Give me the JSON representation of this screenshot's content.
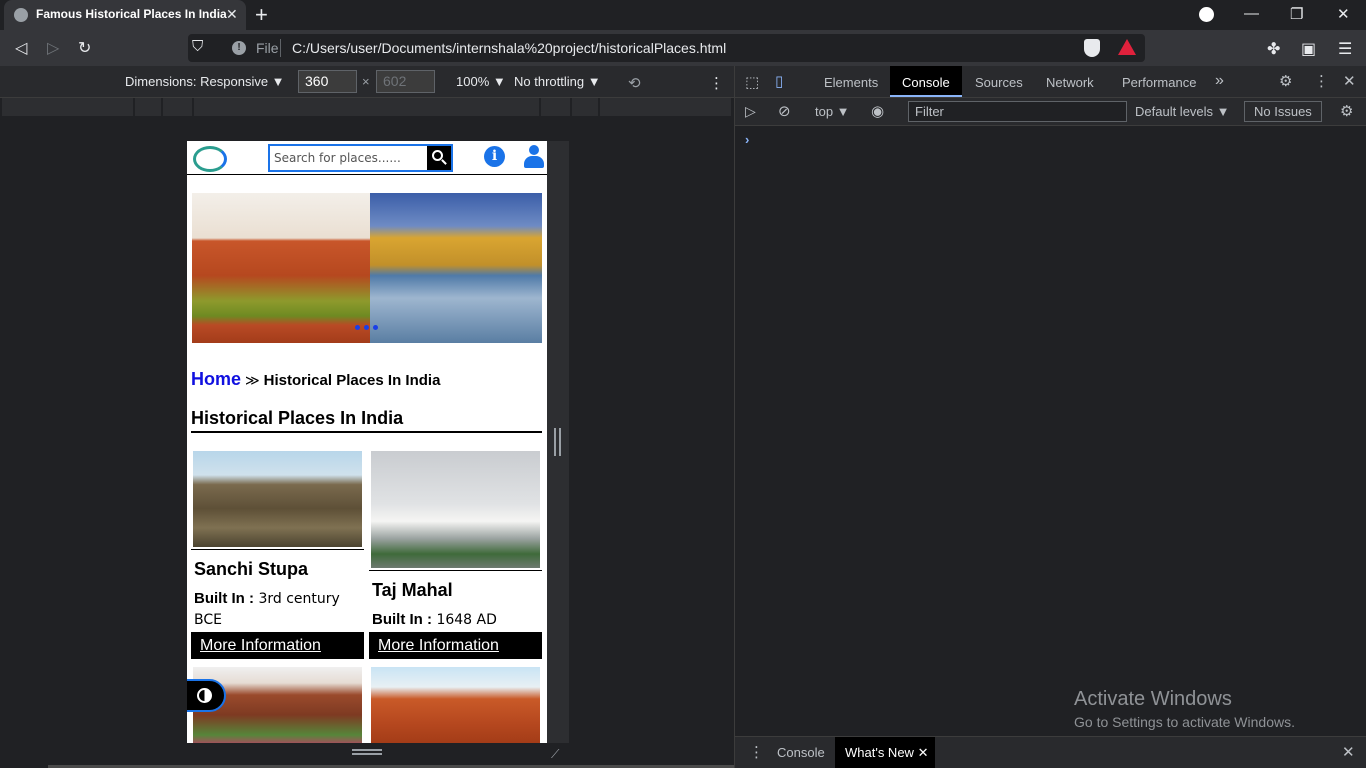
{
  "browser": {
    "tab_title": "Famous Historical Places In India",
    "tab_close": "✕",
    "new_tab": "+",
    "url_scheme": "File",
    "url": "C:/Users/user/Documents/internshala%20project/historicalPlaces.html"
  },
  "device_toolbar": {
    "dimensions_label": "Dimensions: Responsive ▼",
    "width": "360",
    "times": "×",
    "height": "602",
    "zoom": "100% ▼",
    "throttling": "No throttling ▼"
  },
  "site": {
    "search_placeholder": "Search for places......",
    "breadcrumb": {
      "home": "Home",
      "separator": "≫",
      "current": "Historical Places In India"
    },
    "heading": "Historical Places In India",
    "cards": [
      {
        "name": "Sanchi Stupa",
        "built_label": "Built In :",
        "built_value": " 3rd century BCE",
        "more": "More Information"
      },
      {
        "name": "Taj Mahal",
        "built_label": "Built In :",
        "built_value": " 1648 AD",
        "more": "More Information"
      }
    ],
    "colors": {
      "accent": "#1a73e8",
      "link": "#1010e0"
    }
  },
  "devtools": {
    "tabs": [
      "Elements",
      "Console",
      "Sources",
      "Network",
      "Performance"
    ],
    "more_tabs": "»",
    "context": "top ▼",
    "filter_placeholder": "Filter",
    "levels": "Default levels ▼",
    "issues": "No Issues",
    "prompt": "›",
    "drawer_tabs": [
      "Console",
      "What's New"
    ],
    "drawer_close": "✕"
  },
  "watermark": {
    "line1": "Activate Windows",
    "line2": "Go to Settings to activate Windows."
  }
}
